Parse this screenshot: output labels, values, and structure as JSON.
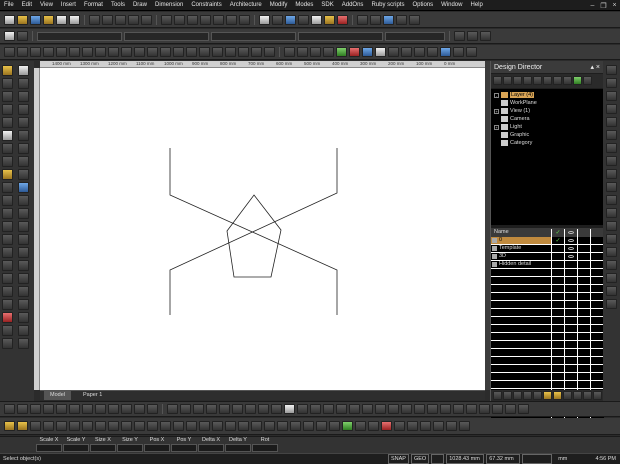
{
  "menu": [
    "File",
    "Edit",
    "View",
    "Insert",
    "Format",
    "Tools",
    "Draw",
    "Dimension",
    "Constraints",
    "Architecture",
    "Modify",
    "Modes",
    "SDK",
    "AddOns",
    "Ruby scripts",
    "Options",
    "Window",
    "Help"
  ],
  "ruler": [
    "1400 mm",
    "1300 mm",
    "1200 mm",
    "1100 mm",
    "1000 mm",
    "900 mm",
    "800 mm",
    "700 mm",
    "600 mm",
    "500 mm",
    "400 mm",
    "300 mm",
    "200 mm",
    "100 mm",
    "0 mm"
  ],
  "sheet_tabs": {
    "model": "Model",
    "paper": "Paper 1"
  },
  "design_director": {
    "title": "Design Director",
    "tree": [
      {
        "label": "Layer (4)",
        "selected": true
      },
      {
        "label": "WorkPlane"
      },
      {
        "label": "View (1)"
      },
      {
        "label": "Camera"
      },
      {
        "label": "Light"
      },
      {
        "label": "Graphic"
      },
      {
        "label": "Category"
      }
    ],
    "layer_header": "Name",
    "layers": [
      "0",
      "Template",
      "3D",
      "Hidden detail"
    ]
  },
  "fields": [
    "Scale X",
    "Scale Y",
    "Size X",
    "Size Y",
    "Pos X",
    "Pos Y",
    "Delta X",
    "Delta Y",
    "Rot"
  ],
  "status": {
    "prompt": "Select object(s)",
    "snap": "SNAP",
    "geo": "GEO",
    "coord_x": "1028.43 mm",
    "coord_y": "67.32 mm",
    "unit": "mm",
    "time": "4:56 PM"
  },
  "colors": {
    "selection": "#d9a455",
    "canvas": "#ffffff",
    "chrome": "#2b2b2b"
  }
}
